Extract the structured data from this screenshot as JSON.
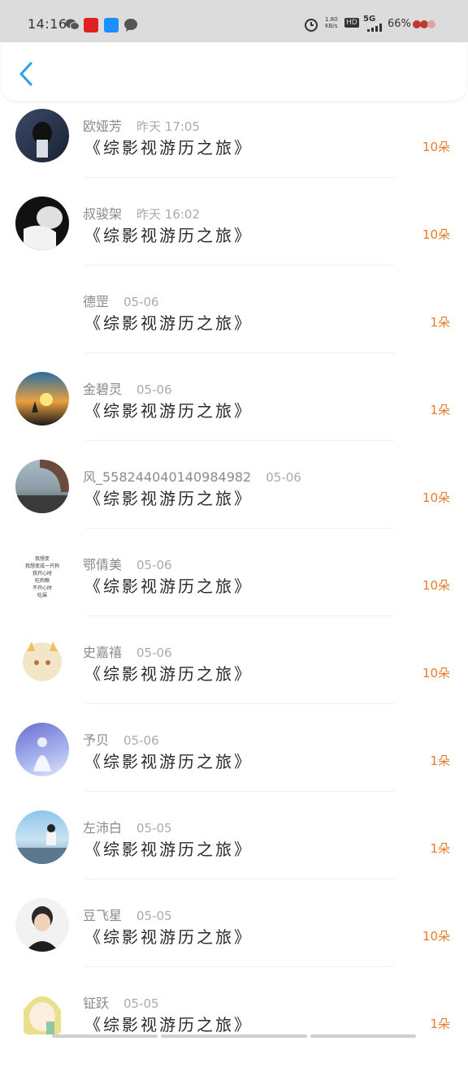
{
  "status_bar": {
    "time": "14:16",
    "net_speed": "1.80 KB/s",
    "hd": "HD",
    "network": "5G",
    "battery": "66%"
  },
  "header": {
    "back_icon": "chevron-left-icon"
  },
  "items": [
    {
      "name": "欧娅芳",
      "date": "昨天 17:05",
      "title": "《综影视游历之旅》",
      "count": "10朵"
    },
    {
      "name": "叔骏架",
      "date": "昨天 16:02",
      "title": "《综影视游历之旅》",
      "count": "10朵"
    },
    {
      "name": "德罡",
      "date": "05-06",
      "title": "《综影视游历之旅》",
      "count": "1朵"
    },
    {
      "name": "金碧灵",
      "date": "05-06",
      "title": "《综影视游历之旅》",
      "count": "1朵"
    },
    {
      "name": "风_558244040140984982",
      "date": "05-06",
      "title": "《综影视游历之旅》",
      "count": "10朵"
    },
    {
      "name": "鄂倩美",
      "date": "05-06",
      "title": "《综影视游历之旅》",
      "count": "10朵"
    },
    {
      "name": "史嘉禧",
      "date": "05-06",
      "title": "《综影视游历之旅》",
      "count": "10朵"
    },
    {
      "name": "予贝",
      "date": "05-06",
      "title": "《综影视游历之旅》",
      "count": "1朵"
    },
    {
      "name": "左沛白",
      "date": "05-05",
      "title": "《综影视游历之旅》",
      "count": "1朵"
    },
    {
      "name": "豆飞星",
      "date": "05-05",
      "title": "《综影视游历之旅》",
      "count": "10朵"
    },
    {
      "name": "钲跃",
      "date": "05-05",
      "title": "《综影视游历之旅》",
      "count": "1朵"
    }
  ],
  "avatar_text": [
    "我想变",
    "我想变成一只狗",
    "我开心时",
    "吃狗粮",
    "不开心时",
    "吃屎"
  ],
  "colors": {
    "accent": "#2aa0e0",
    "count": "#e97a2a"
  }
}
